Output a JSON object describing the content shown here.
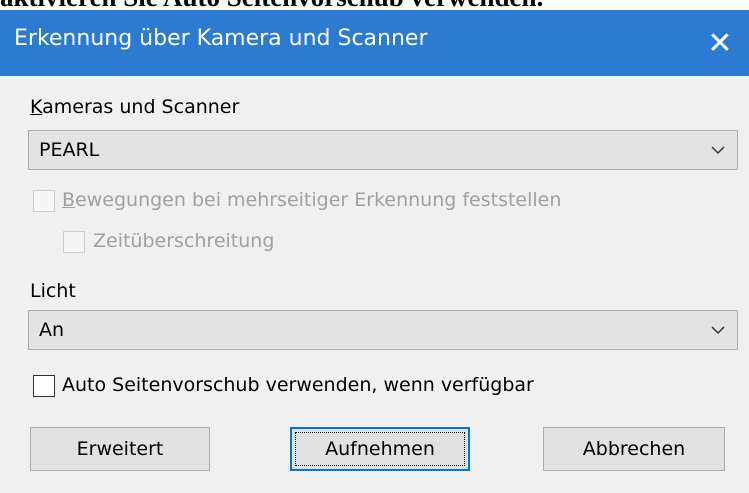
{
  "banner": {
    "text": "aktivieren Sie Auto Seitenvorschub verwenden."
  },
  "window": {
    "title": "Erkennung über Kamera und Scanner",
    "close_glyph": "✕"
  },
  "cameras": {
    "label_prefix": "K",
    "label_rest": "ameras und Scanner",
    "selected": "PEARL"
  },
  "motion": {
    "prefix": "B",
    "rest": "ewegungen bei mehrseitiger Erkennung feststellen",
    "checked": false,
    "enabled": false
  },
  "timeout": {
    "label": "Zeitüberschreitung",
    "checked": false,
    "enabled": false
  },
  "light": {
    "label": "Licht",
    "selected": "An"
  },
  "autofeed": {
    "label": "Auto Seitenvorschub verwenden, wenn verfügbar",
    "checked": false
  },
  "buttons": {
    "advanced": "Erweitert",
    "capture": "Aufnehmen",
    "cancel": "Abbrechen"
  }
}
